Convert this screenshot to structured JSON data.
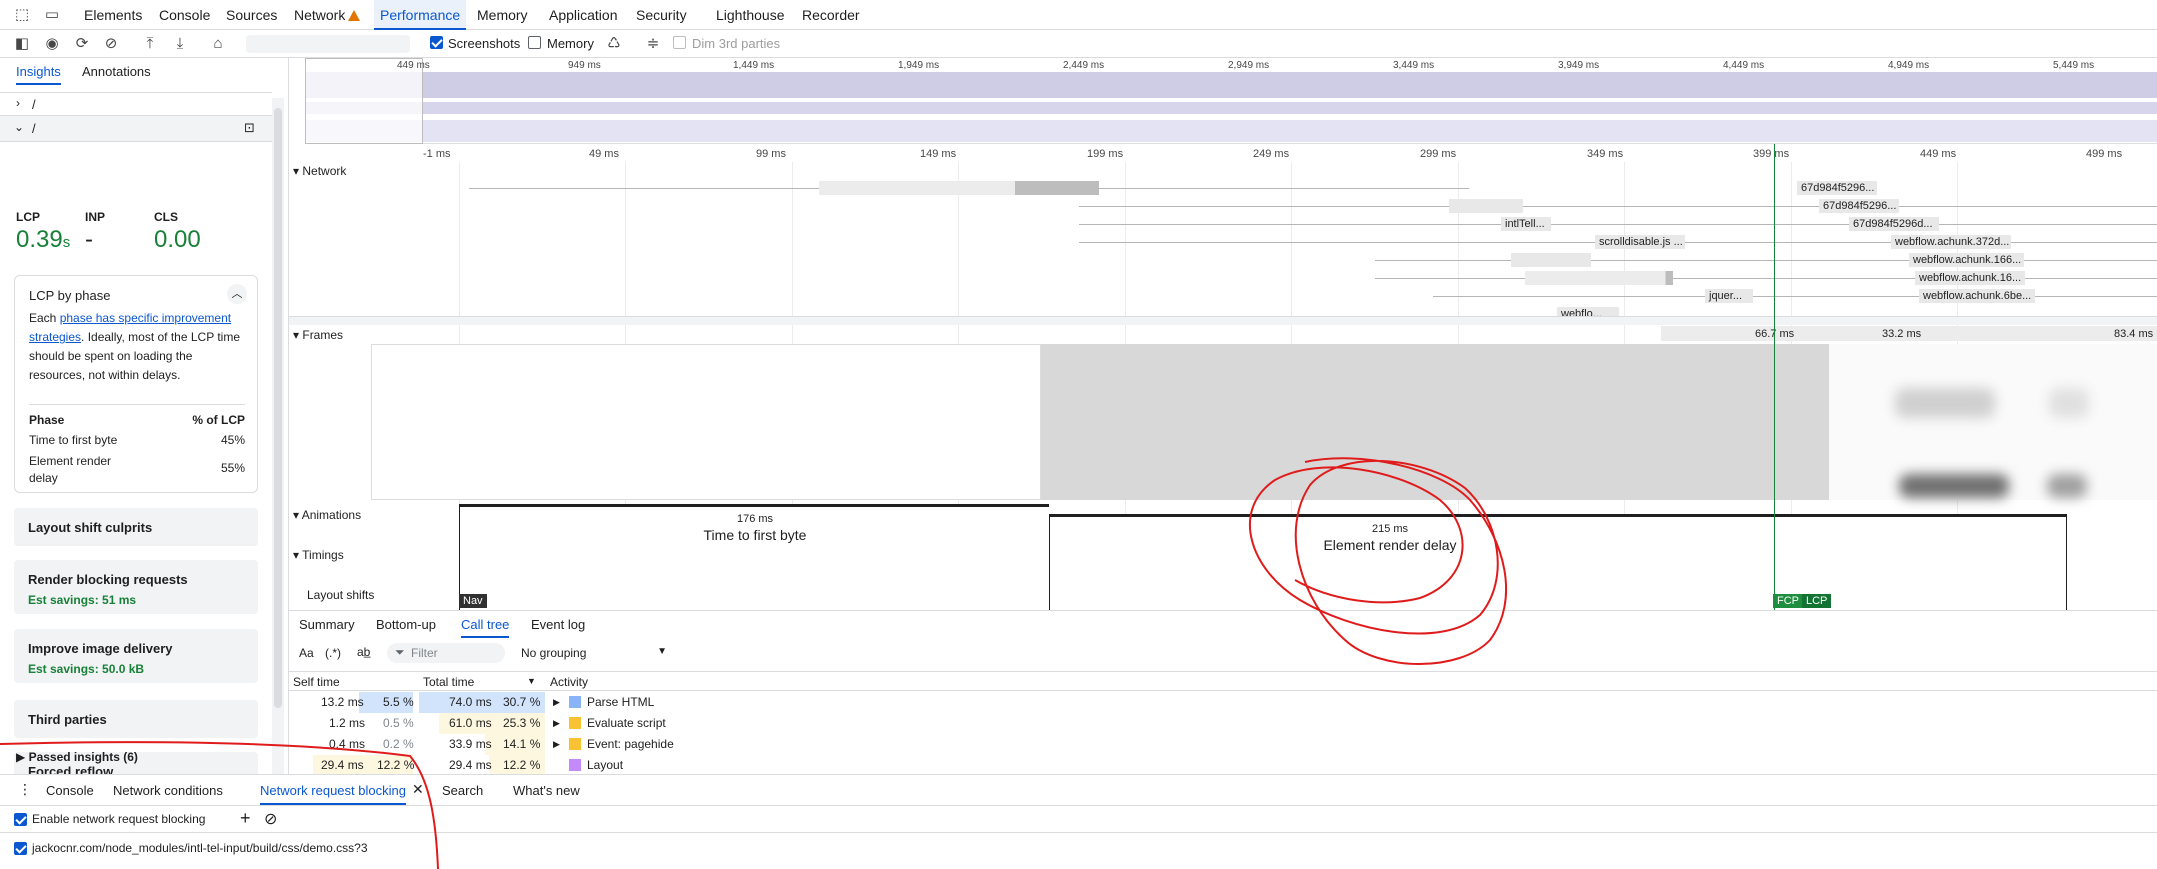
{
  "devtools_tabs": [
    "Elements",
    "Console",
    "Sources",
    "Network",
    "Performance",
    "Memory",
    "Application",
    "Security",
    "Lighthouse",
    "Recorder"
  ],
  "toolbar": {
    "screenshots_label": "Screenshots",
    "memory_label": "Memory",
    "dim_label": "Dim 3rd parties"
  },
  "overview_labels": [
    "449 ms",
    "949 ms",
    "1,449 ms",
    "1,949 ms",
    "2,449 ms",
    "2,949 ms",
    "3,449 ms",
    "3,949 ms",
    "4,449 ms",
    "4,949 ms",
    "5,449 ms"
  ],
  "sidebar": {
    "tabs": [
      "Insights",
      "Annotations"
    ],
    "nav1": "/",
    "nav2": "/",
    "metrics": [
      {
        "name": "LCP",
        "value": "0.39",
        "unit": "s",
        "color": "#188038"
      },
      {
        "name": "INP",
        "value": "-",
        "unit": "",
        "color": "#1f1f1f"
      },
      {
        "name": "CLS",
        "value": "0.00",
        "unit": "",
        "color": "#188038"
      }
    ],
    "lcp_phase": {
      "title": "LCP by phase",
      "desc_pre": "Each ",
      "desc_link": "phase has specific improvement strategies",
      "desc_post": ". Ideally, most of the LCP time should be spent on loading the resources, not within delays.",
      "col_phase": "Phase",
      "col_pct": "% of LCP",
      "rows": [
        {
          "phase": "Time to first byte",
          "pct": "45%"
        },
        {
          "phase": "Element render delay",
          "pct": "55%"
        }
      ]
    },
    "insights": [
      {
        "title": "Layout shift culprits",
        "sub": ""
      },
      {
        "title": "Render blocking requests",
        "sub": "Est savings: 51 ms"
      },
      {
        "title": "Improve image delivery",
        "sub": "Est savings: 50.0 kB"
      },
      {
        "title": "Third parties",
        "sub": ""
      },
      {
        "title": "Forced reflow",
        "sub": ""
      }
    ],
    "passed": "Passed insights (6)"
  },
  "ruler_labels": [
    "-1 ms",
    "49 ms",
    "99 ms",
    "149 ms",
    "199 ms",
    "249 ms",
    "299 ms",
    "349 ms",
    "399 ms",
    "449 ms",
    "499 ms"
  ],
  "tracks": {
    "network": "Network",
    "frames": "Frames",
    "animations": "Animations",
    "timings": "Timings",
    "layout_shifts": "Layout shifts"
  },
  "network_requests": [
    "67d984f5296...",
    "67d984f5296...",
    "67d984f5296d...",
    "intlTell...",
    "scrolldisable.js ...",
    "webflow.achunk.372d...",
    "webflow.achunk.166...",
    "webflow.achunk.16...",
    "webflow.achunk.6be...",
    "jquer...",
    "webflo..."
  ],
  "frames_times": [
    "66.7 ms",
    "33.2 ms",
    "83.4 ms"
  ],
  "phases": [
    {
      "duration": "176 ms",
      "label": "Time to first byte"
    },
    {
      "duration": "215 ms",
      "label": "Element render delay"
    }
  ],
  "markers": {
    "nav": "Nav",
    "fcp": "FCP",
    "lcp": "LCP"
  },
  "bottom": {
    "tabs": [
      "Summary",
      "Bottom-up",
      "Call tree",
      "Event log"
    ],
    "filter_placeholder": "Filter",
    "grouping": "No grouping",
    "col_self": "Self time",
    "col_total": "Total time",
    "col_activity": "Activity",
    "rows": [
      {
        "self_ms": "13.2 ms",
        "self_pct": "5.5 %",
        "total_ms": "74.0 ms",
        "total_pct": "30.7 %",
        "activity": "Parse HTML",
        "color": "#8ab4f8",
        "total_fraction": 0.307
      },
      {
        "self_ms": "1.2 ms",
        "self_pct": "0.5 %",
        "total_ms": "61.0 ms",
        "total_pct": "25.3 %",
        "activity": "Evaluate script",
        "color": "#f9c233",
        "total_fraction": 0.253
      },
      {
        "self_ms": "0.4 ms",
        "self_pct": "0.2 %",
        "total_ms": "33.9 ms",
        "total_pct": "14.1 %",
        "activity": "Event: pagehide",
        "color": "#f9c233",
        "total_fraction": 0.141
      },
      {
        "self_ms": "29.4 ms",
        "self_pct": "12.2 %",
        "total_ms": "29.4 ms",
        "total_pct": "12.2 %",
        "activity": "Layout",
        "color": "#c58af9",
        "total_fraction": 0.122
      }
    ]
  },
  "drawer": {
    "tabs": [
      "Console",
      "Network conditions",
      "Network request blocking",
      "Search",
      "What's new"
    ],
    "enable_label": "Enable network request blocking",
    "pattern": "jackocnr.com/node_modules/intl-tel-input/build/css/demo.css?3"
  }
}
